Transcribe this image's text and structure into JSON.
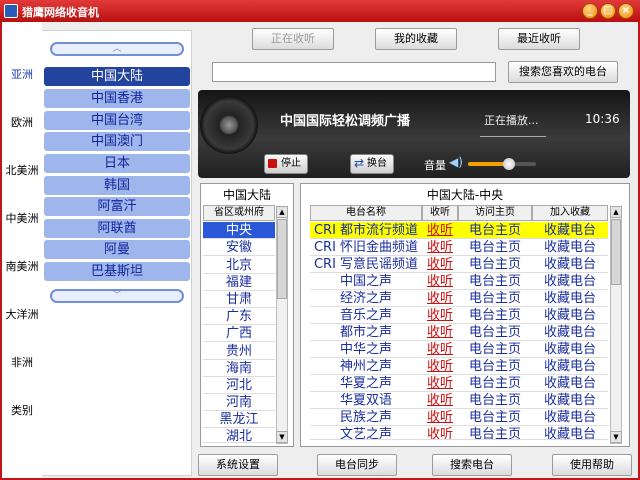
{
  "window": {
    "title": "猎鹰网络收音机",
    "min": "_",
    "max": "□",
    "close": "×"
  },
  "continents": [
    "亚洲",
    "欧洲",
    "北美洲",
    "中美洲",
    "南美洲",
    "大洋洲",
    "非洲",
    "类别"
  ],
  "continent_selected": "亚洲",
  "regions": [
    "中国大陆",
    "中国香港",
    "中国台湾",
    "中国澳门",
    "日本",
    "韩国",
    "阿富汗",
    "阿联酋",
    "阿曼",
    "巴基斯坦"
  ],
  "region_selected": "中国大陆",
  "top_buttons": {
    "now_playing": "正在收听",
    "my_favorites": "我的收藏",
    "recent": "最近收听"
  },
  "search": {
    "value": "",
    "button": "搜索您喜欢的电台"
  },
  "player": {
    "station": "中国国际轻松调频广播",
    "status": "正在播放...",
    "time": "10:36",
    "stop_label": "停止",
    "switch_label": "换台",
    "volume_label": "音量",
    "volume_level": 0.6
  },
  "province_panel": {
    "title": "中国大陆",
    "header": "省区或州府",
    "items": [
      "中央",
      "安徽",
      "北京",
      "福建",
      "甘肃",
      "广东",
      "广西",
      "贵州",
      "海南",
      "河北",
      "河南",
      "黑龙江",
      "湖北"
    ],
    "selected": "中央"
  },
  "station_table": {
    "title": "中国大陆-中央",
    "headers": [
      "电台名称",
      "收听",
      "访问主页",
      "加入收藏"
    ],
    "rows": [
      {
        "name": "CRI 都市流行频道",
        "listen": "收听",
        "home": "电台主页",
        "fav": "收藏电台"
      },
      {
        "name": "CRI 怀旧金曲频道",
        "listen": "收听",
        "home": "电台主页",
        "fav": "收藏电台"
      },
      {
        "name": "CRI 写意民谣频道",
        "listen": "收听",
        "home": "电台主页",
        "fav": "收藏电台"
      },
      {
        "name": "中国之声",
        "listen": "收听",
        "home": "电台主页",
        "fav": "收藏电台"
      },
      {
        "name": "经济之声",
        "listen": "收听",
        "home": "电台主页",
        "fav": "收藏电台"
      },
      {
        "name": "音乐之声",
        "listen": "收听",
        "home": "电台主页",
        "fav": "收藏电台"
      },
      {
        "name": "都市之声",
        "listen": "收听",
        "home": "电台主页",
        "fav": "收藏电台"
      },
      {
        "name": "中华之声",
        "listen": "收听",
        "home": "电台主页",
        "fav": "收藏电台"
      },
      {
        "name": "神州之声",
        "listen": "收听",
        "home": "电台主页",
        "fav": "收藏电台"
      },
      {
        "name": "华夏之声",
        "listen": "收听",
        "home": "电台主页",
        "fav": "收藏电台"
      },
      {
        "name": "华夏双语",
        "listen": "收听",
        "home": "电台主页",
        "fav": "收藏电台"
      },
      {
        "name": "民族之声",
        "listen": "收听",
        "home": "电台主页",
        "fav": "收藏电台"
      },
      {
        "name": "文艺之声",
        "listen": "收听",
        "home": "电台主页",
        "fav": "收藏电台"
      }
    ],
    "highlight_index": 0
  },
  "bottom_buttons": {
    "settings": "系统设置",
    "sync": "电台同步",
    "search": "搜索电台",
    "help": "使用帮助"
  }
}
